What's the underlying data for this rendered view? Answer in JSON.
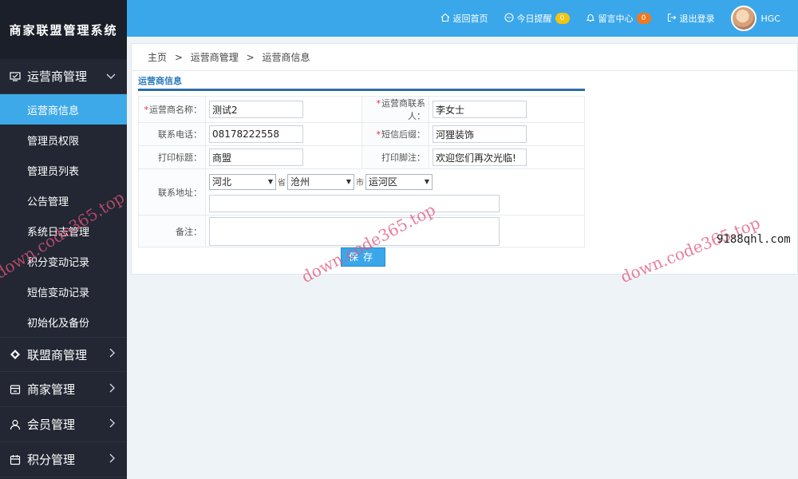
{
  "app": {
    "title": "商家联盟管理系统"
  },
  "topbar": {
    "home": "返回首页",
    "today": "今日提醒",
    "today_count": "0",
    "messages": "留言中心",
    "messages_count": "0",
    "logout": "退出登录",
    "user": "HGC"
  },
  "sidebar": {
    "groups": [
      {
        "label": "运营商管理",
        "icon": "monitor-icon",
        "expanded": true
      },
      {
        "label": "联盟商管理",
        "icon": "diamond-icon"
      },
      {
        "label": "商家管理",
        "icon": "store-icon"
      },
      {
        "label": "会员管理",
        "icon": "user-icon"
      },
      {
        "label": "积分管理",
        "icon": "calendar-icon"
      }
    ],
    "sub_items": [
      {
        "label": "运营商信息",
        "active": true
      },
      {
        "label": "管理员权限"
      },
      {
        "label": "管理员列表"
      },
      {
        "label": "公告管理"
      },
      {
        "label": "系统日志管理"
      },
      {
        "label": "积分变动记录"
      },
      {
        "label": "短信变动记录"
      },
      {
        "label": "初始化及备份"
      }
    ]
  },
  "breadcrumb": {
    "items": [
      "主页",
      "运营商管理",
      "运营商信息"
    ],
    "sep": ">"
  },
  "section_title": "运营商信息",
  "form": {
    "name_label": "运营商名称：",
    "name_value": "测试2",
    "contact_label": "运营商联系人：",
    "contact_value": "李女士",
    "phone_label": "联系电话：",
    "phone_value": "08178222558",
    "sms_label": "短信后缀：",
    "sms_value": "河狸装饰",
    "print_title_label": "打印标题：",
    "print_title_value": "商盟",
    "print_footer_label": "打印脚注：",
    "print_footer_value": "欢迎您们再次光临!",
    "address_label": "联系地址：",
    "province": "河北",
    "province_unit": "省",
    "city": "沧州",
    "city_unit": "市",
    "district": "运河区",
    "address_detail": "",
    "remark_label": "备注：",
    "remark_value": "",
    "save": "保存"
  },
  "watermarks": {
    "site": "down.code365.top",
    "side": "9188qhl.com"
  }
}
